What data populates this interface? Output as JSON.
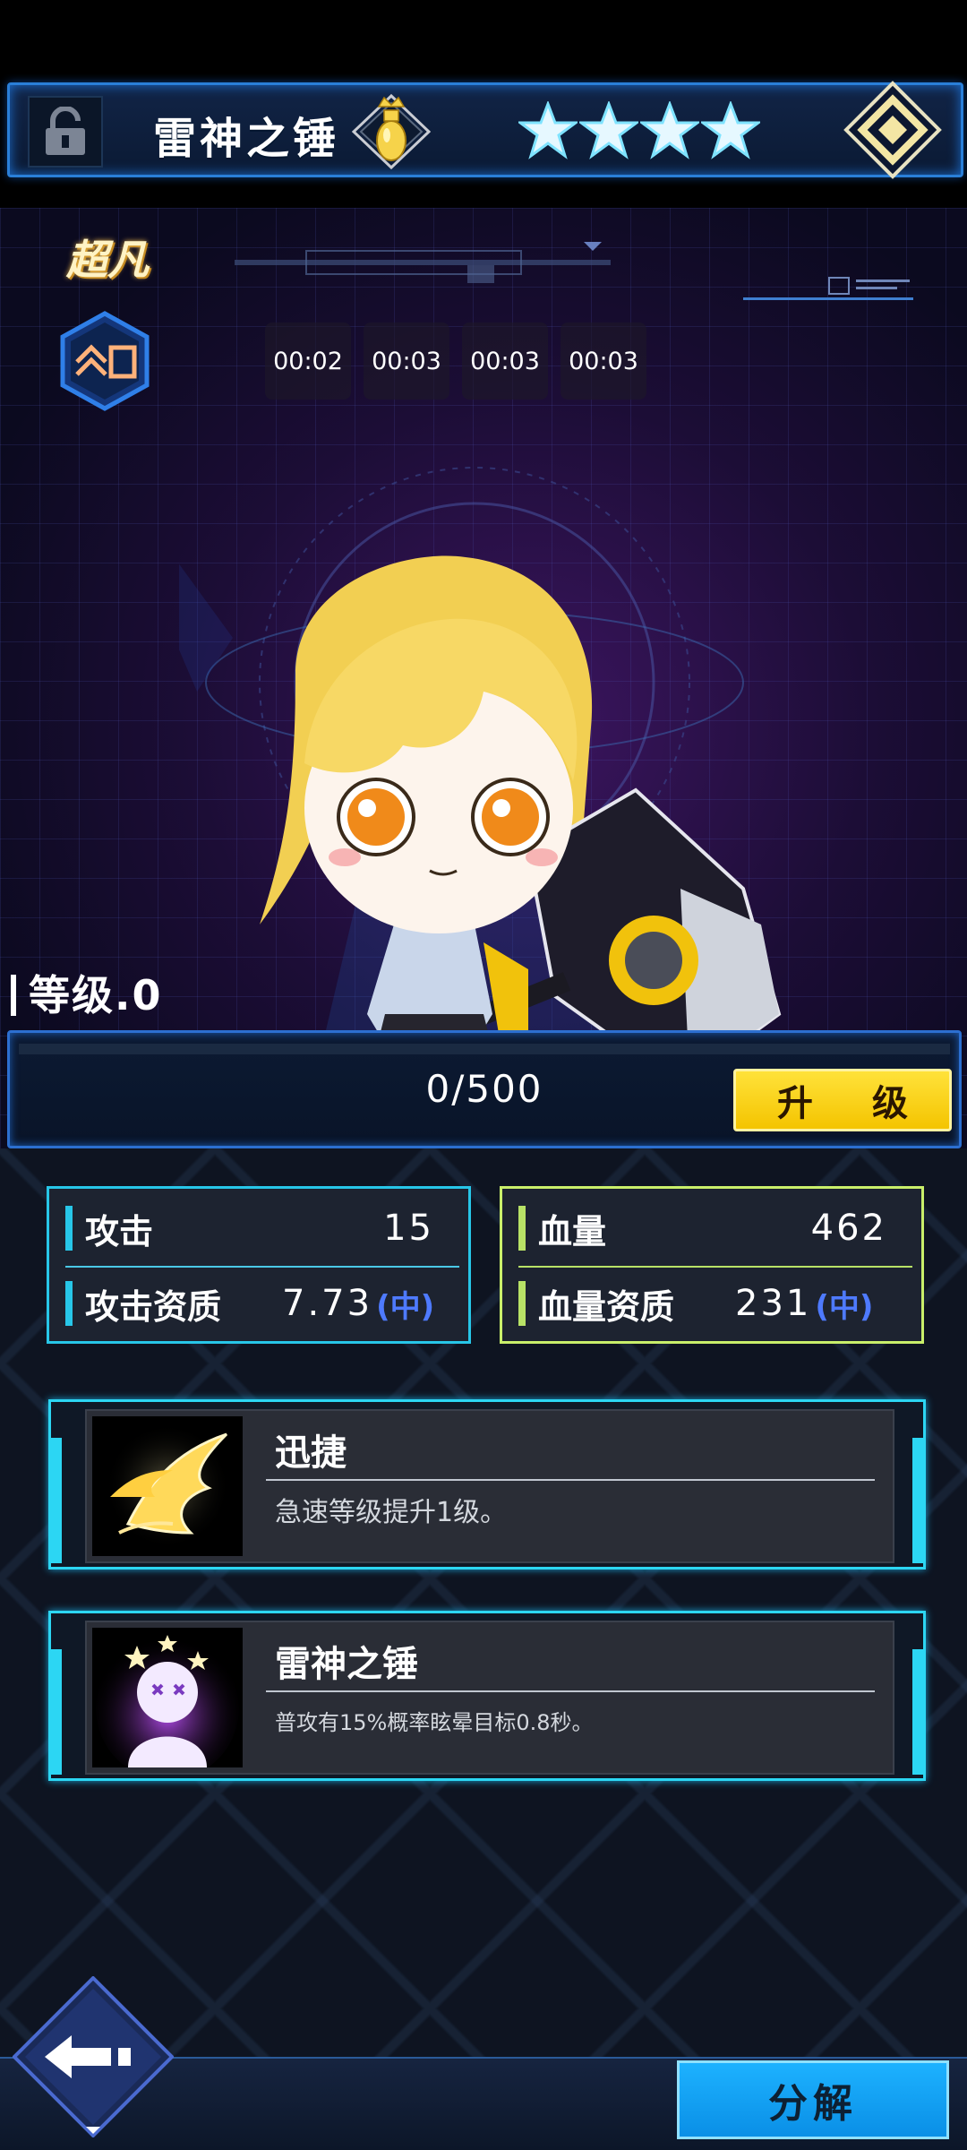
{
  "header": {
    "weapon_name": "雷神之锤",
    "star_count": 4,
    "icons": [
      "lock-icon",
      "crown-emblem-icon",
      "star-icon",
      "diamond-rank-icon"
    ]
  },
  "scene": {
    "rarity": "超凡",
    "rank_badge_icon": "rank-up-hex-icon",
    "timers": [
      "00:02",
      "00:03",
      "00:03",
      "00:03"
    ]
  },
  "level": {
    "label": "等级.0",
    "xp_text": "0/500",
    "xp_progress": 0,
    "upgrade_label": "升 级"
  },
  "stats": {
    "attack": {
      "name": "攻击",
      "value": "15",
      "aptitude_name": "攻击资质",
      "aptitude_value": "7.73",
      "aptitude_grade": "(中)"
    },
    "hp": {
      "name": "血量",
      "value": "462",
      "aptitude_name": "血量资质",
      "aptitude_value": "231",
      "aptitude_grade": "(中)"
    }
  },
  "skills": [
    {
      "name": "迅捷",
      "desc": "急速等级提升1级。",
      "icon": "feather-wing-icon"
    },
    {
      "name": "雷神之锤",
      "desc": "普攻有15%概率眩晕目标0.8秒。",
      "icon": "stun-stars-icon"
    }
  ],
  "footer": {
    "back_icon": "back-arrow-icon",
    "decompose_label": "分解"
  },
  "colors": {
    "attack_accent": "#27c6e8",
    "hp_accent": "#c9ef6a",
    "upgrade_yellow": "#f4c400",
    "decompose_blue": "#1db2ff",
    "grade_blue": "#4e7aff"
  }
}
